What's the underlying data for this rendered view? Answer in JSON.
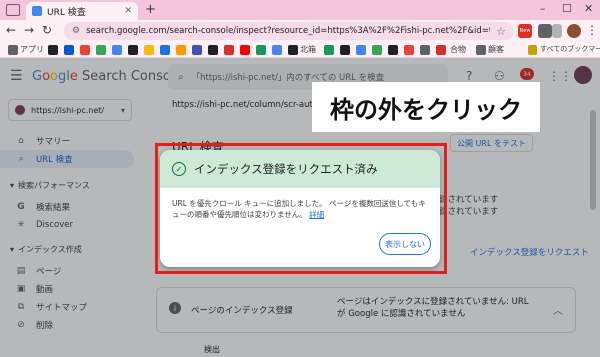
{
  "browser": {
    "tab_title": "URL 検査",
    "url": "search.google.com/search-console/inspect?resource_id=https%3A%2F%2Fishi-pc.net%2F&id=tCzFo7goY3bio7HwRtMyrQ",
    "bookmarks": {
      "apps_label": "アプリ",
      "kitaku_label": "北箱",
      "goumono_label": "合物",
      "keiei_label": "顧客",
      "all_bookmarks_label": "すべてのブックマーク"
    },
    "new_badge": "New"
  },
  "header": {
    "product_name": "Google Search Console",
    "search_placeholder": "「https://ishi-pc.net/」内のすべての URL を検査",
    "notification_count": "34"
  },
  "sidebar": {
    "property": "https://ishi-pc.net/",
    "items": [
      {
        "icon": "home-icon",
        "label": "サマリー"
      },
      {
        "icon": "search-icon",
        "label": "URL 検査"
      }
    ],
    "section_performance": "検索パフォーマンス",
    "perf_items": [
      {
        "icon": "google-g-icon",
        "label": "検索結果"
      },
      {
        "icon": "discover-icon",
        "label": "Discover"
      }
    ],
    "section_index": "インデックス作成",
    "index_items": [
      {
        "icon": "page-icon",
        "label": "ページ"
      },
      {
        "icon": "video-icon",
        "label": "動画"
      },
      {
        "icon": "sitemap-icon",
        "label": "サイトマップ"
      },
      {
        "icon": "delete-icon",
        "label": "削除"
      }
    ]
  },
  "main": {
    "inspected_url": "https://ishi-pc.net/column/scr-auto-off/",
    "title": "URL 検査",
    "test_button": "公開 URL をテスト",
    "card_right_text": "に登録されています\nに登録されています",
    "request_link": "インデックス登録をリクエスト",
    "index_row_label": "ページのインデックス登録",
    "index_row_desc": "ページはインデックスに登録されていません: URL が Google に認識されていません",
    "detect_label": "検出"
  },
  "dialog": {
    "title": "インデックス登録をリクエスト済み",
    "body": "URL を優先クロール キューに追加しました。 ページを複数回送信してもキューの順番や優先順位は変わりません。",
    "details_link": "詳細",
    "dismiss_button": "表示しない"
  },
  "overlay_note": "枠の外をクリック",
  "colors": {
    "accent": "#1a73e8",
    "success_bg": "#ceead6",
    "highlight_frame": "#e0201b"
  }
}
